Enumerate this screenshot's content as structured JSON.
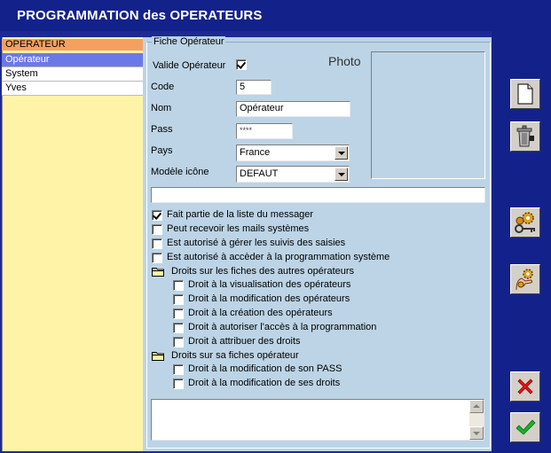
{
  "window": {
    "title": "PROGRAMMATION des OPERATEURS"
  },
  "operator_list": {
    "header": "OPERATEUR",
    "items": [
      {
        "label": "Opérateur",
        "selected": true
      },
      {
        "label": "System",
        "selected": false
      },
      {
        "label": "Yves",
        "selected": false
      }
    ]
  },
  "form": {
    "group_title": "Fiche Opérateur",
    "valid_label": "Valide Opérateur",
    "valid_checked": true,
    "code_label": "Code",
    "code_value": "5",
    "nom_label": "Nom",
    "nom_value": "Opérateur",
    "pass_label": "Pass",
    "pass_value": "****",
    "pays_label": "Pays",
    "pays_value": "France",
    "icone_label": "Modèle icône",
    "icone_value": "DEFAUT",
    "photo_label": "Photo",
    "long_field_value": ""
  },
  "options": {
    "messager": "Fait partie de la liste du messager",
    "mails": "Peut recevoir les mails systèmes",
    "suivis": "Est autorisé à gérer les suivis des saisies",
    "programmation": "Est autorisé à accèder à la programmation système",
    "group_autres": "Droits sur les fiches des autres opérateurs",
    "autres": [
      "Droit à la visualisation des opérateurs",
      "Droit à la modification des opérateurs",
      "Droit à la création des opérateurs",
      "Droit à autoriser l'accès à la programmation",
      "Droit à attribuer des droits"
    ],
    "group_sa": "Droits sur sa fiches opérateur",
    "sa": [
      "Droit à la modification de son PASS",
      "Droit à la modification de ses droits"
    ]
  },
  "toolbar": {
    "new_icon": "new-document-icon",
    "delete_icon": "trash-icon",
    "config_icon": "gear-key-icon",
    "rights_icon": "hand-gear-icon",
    "cancel_icon": "red-x-icon",
    "ok_icon": "green-check-icon"
  },
  "colors": {
    "title_bar": "#13228a",
    "panel": "#bcd4e6",
    "list_bg": "#fff3a8",
    "list_header": "#f5a060",
    "selected": "#6b78e8"
  }
}
